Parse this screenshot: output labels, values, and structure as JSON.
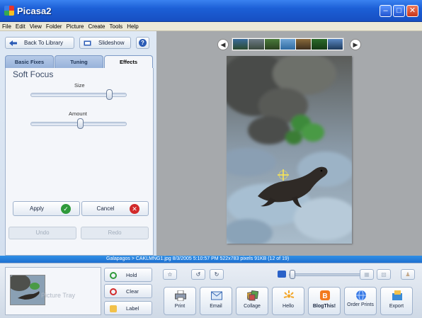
{
  "window": {
    "title": "Picasa2",
    "controls": [
      "minimize",
      "maximize",
      "close"
    ]
  },
  "menu": [
    "File",
    "Edit",
    "View",
    "Folder",
    "Picture",
    "Create",
    "Tools",
    "Help"
  ],
  "toolbar": {
    "back_label": "Back To Library",
    "slideshow_label": "Slideshow",
    "help_label": "?"
  },
  "tabs": [
    {
      "label": "Basic Fixes",
      "active": false
    },
    {
      "label": "Tuning",
      "active": false
    },
    {
      "label": "Effects",
      "active": true
    }
  ],
  "effect": {
    "title": "Soft Focus",
    "size_label": "Size",
    "size_value": 0.82,
    "amount_label": "Amount",
    "amount_value": 0.52,
    "apply_label": "Apply",
    "cancel_label": "Cancel",
    "undo_label": "Undo",
    "redo_label": "Redo"
  },
  "status": {
    "text": "Galapagos > CAKLMNG1.jpg   8/3/2005 5:10:57 PM   522x783 pixels   91KB   (12 of 19)"
  },
  "tray": {
    "label": "Picture Tray",
    "hold_label": "Hold",
    "clear_label": "Clear",
    "label_label": "Label"
  },
  "actions": [
    {
      "label": "Print",
      "icon": "printer-icon"
    },
    {
      "label": "Email",
      "icon": "email-icon"
    },
    {
      "label": "Collage",
      "icon": "collage-icon"
    },
    {
      "label": "Hello",
      "icon": "hello-icon"
    },
    {
      "label": "BlogThis!",
      "icon": "blogger-icon"
    },
    {
      "label": "Order Prints",
      "icon": "order-prints-icon"
    },
    {
      "label": "Export",
      "icon": "export-icon"
    }
  ],
  "colors": {
    "accent": "#2a62c8",
    "apply_green": "#2f9a3a",
    "cancel_red": "#d22a2a"
  }
}
